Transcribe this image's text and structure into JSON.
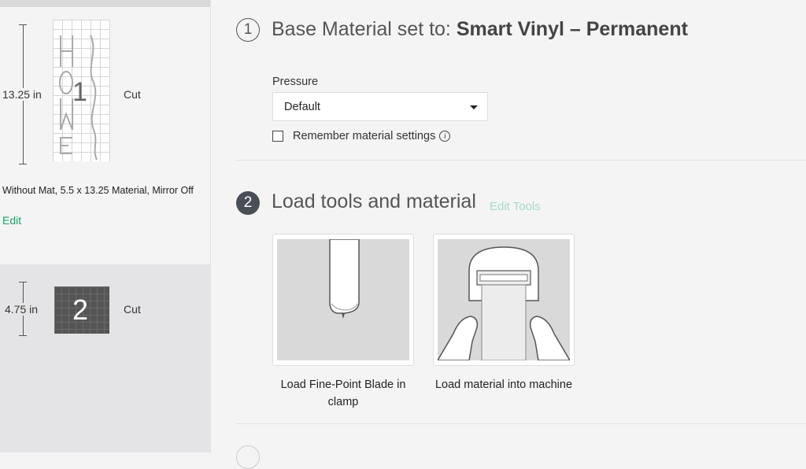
{
  "sidebar": {
    "mats": [
      {
        "number": "1",
        "height_label": "13.25 in",
        "action": "Cut",
        "info": "Without Mat, 5.5 x 13.25 Material, Mirror Off",
        "edit_label": "Edit"
      },
      {
        "number": "2",
        "height_label": "4.75 in",
        "action": "Cut"
      }
    ]
  },
  "step1": {
    "number": "1",
    "title_prefix": "Base Material set to: ",
    "material": "Smart Vinyl – Permanent",
    "pressure_label": "Pressure",
    "pressure_value": "Default",
    "remember_label": "Remember material settings"
  },
  "step2": {
    "number": "2",
    "title": "Load tools and material",
    "edit_tools": "Edit Tools",
    "cards": [
      {
        "caption": "Load Fine-Point Blade in clamp"
      },
      {
        "caption": "Load material into machine"
      }
    ]
  },
  "colors": {
    "accent_green": "#1aa167",
    "step_active": "#4a4f55"
  }
}
